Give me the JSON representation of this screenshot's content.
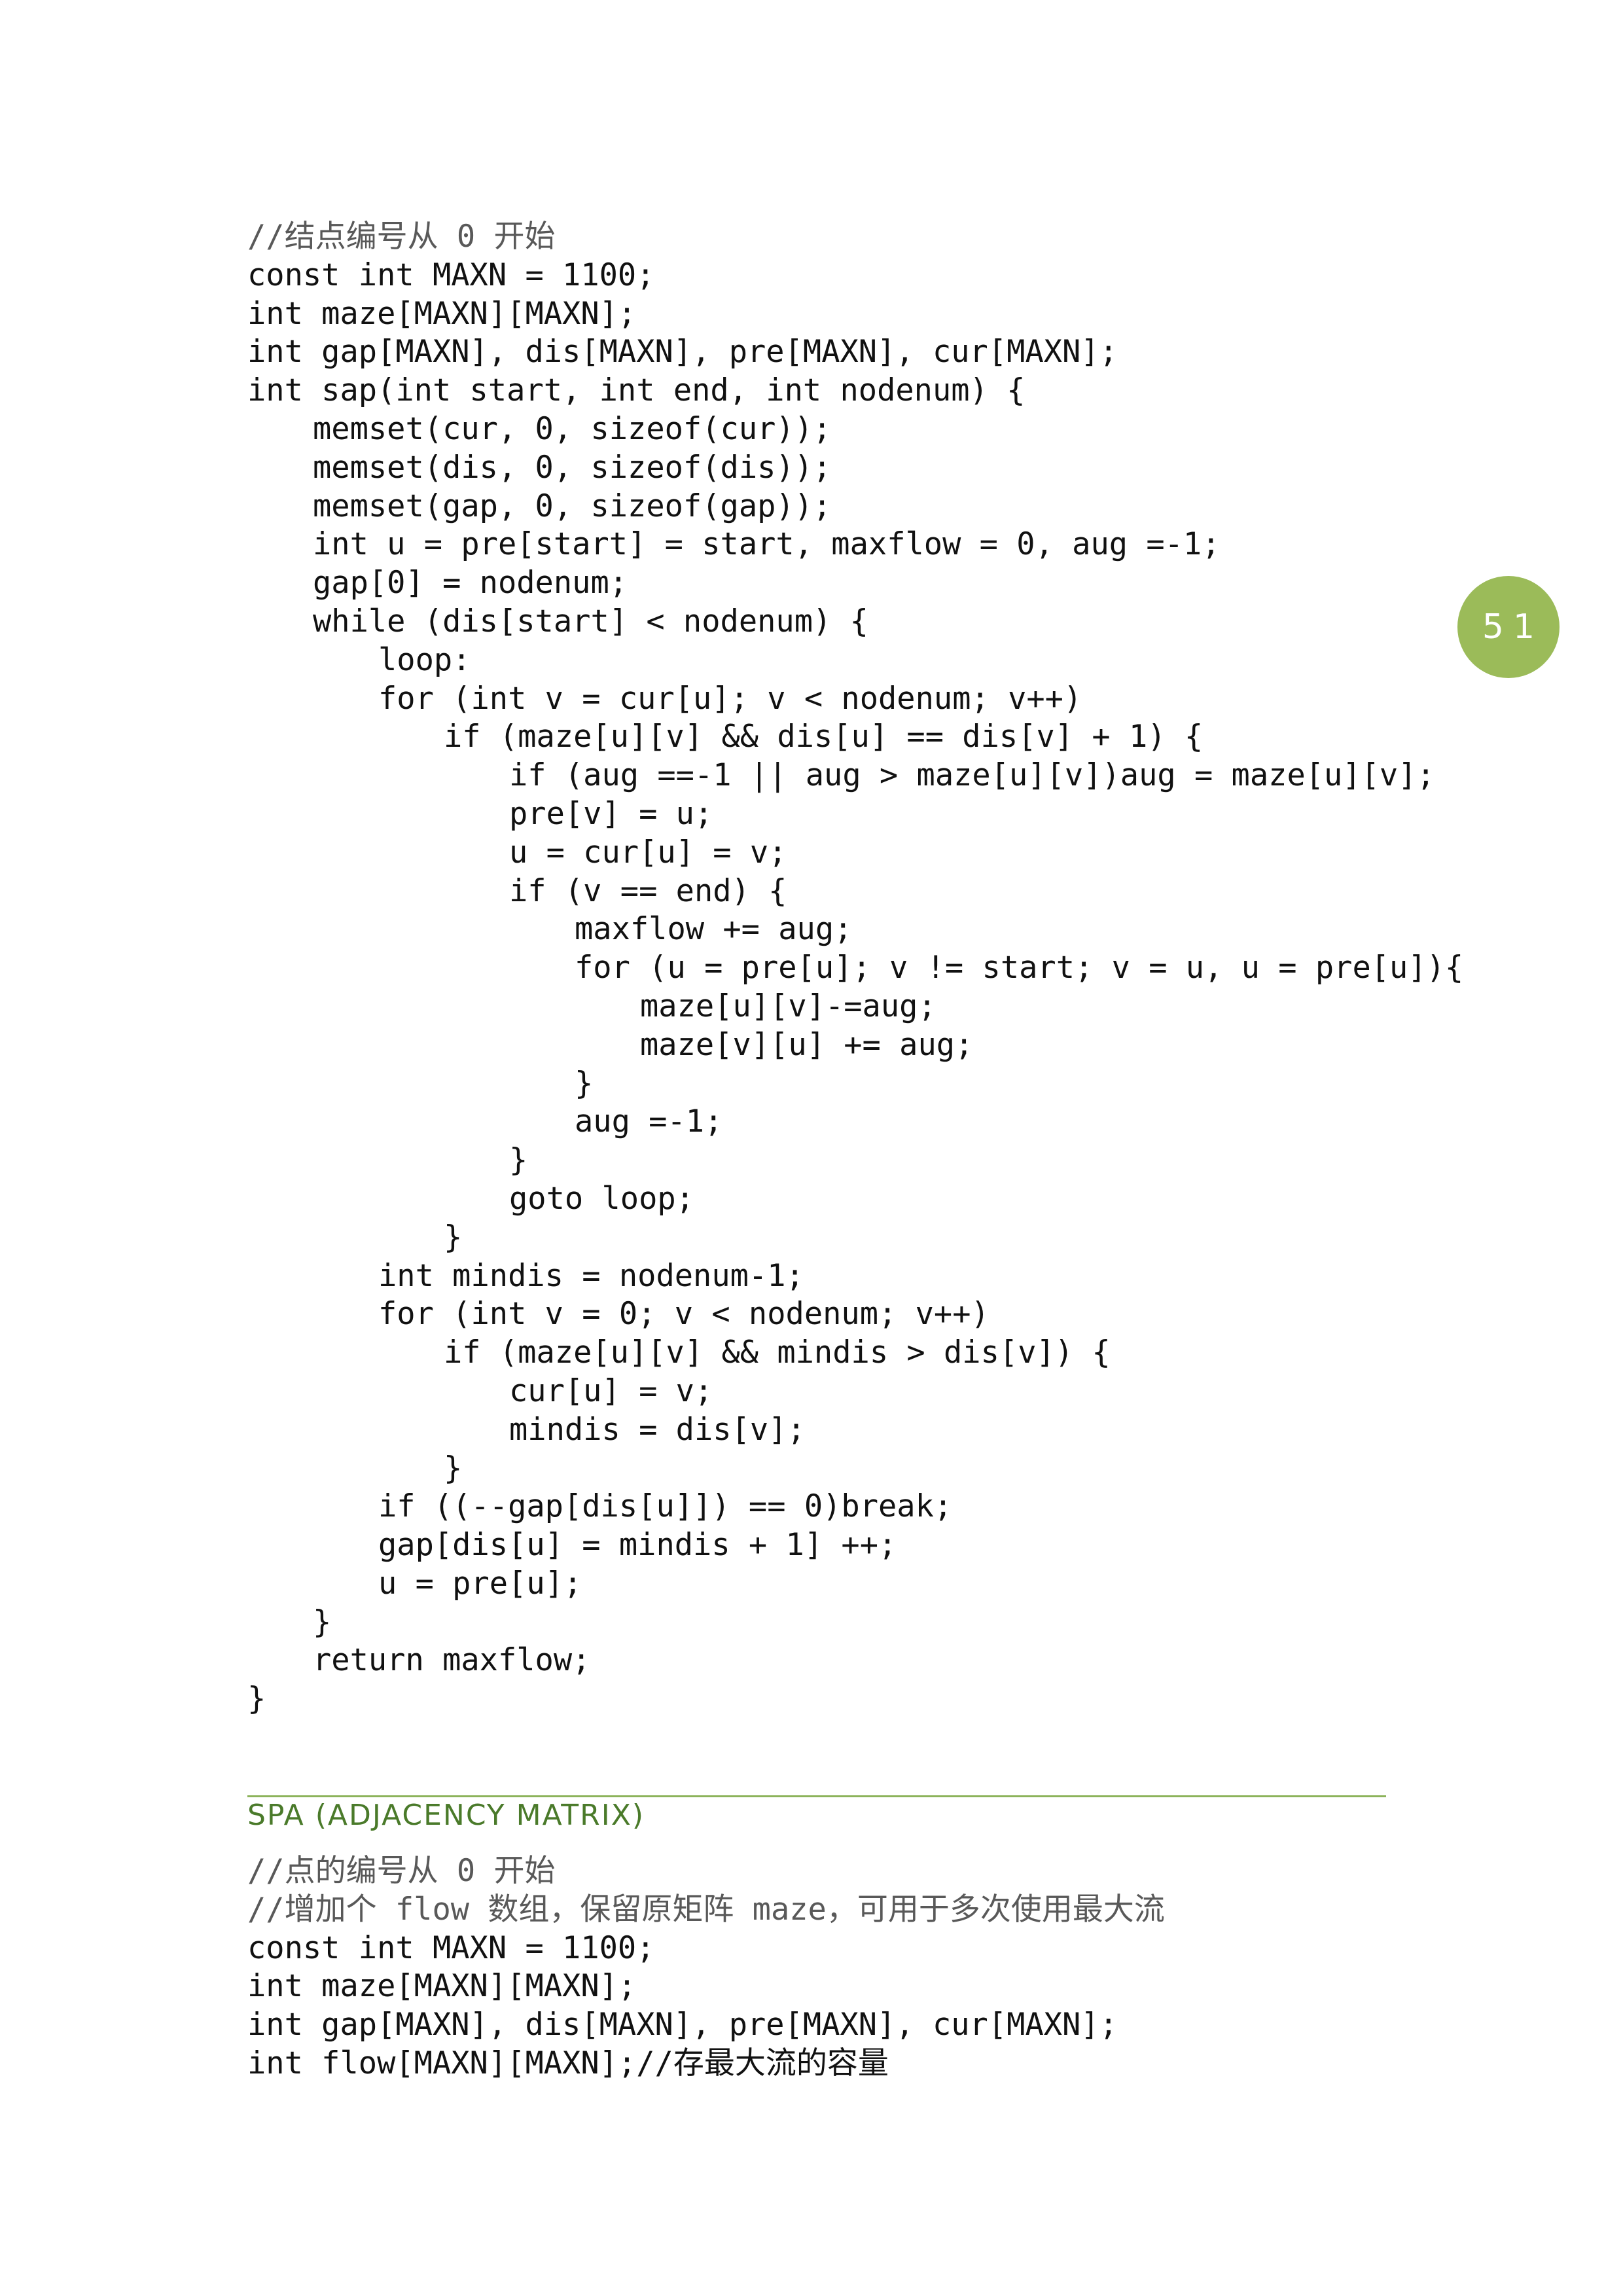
{
  "block1_lines": [
    {
      "indent": 0,
      "text": "//结点编号从 0 开始",
      "comment": true
    },
    {
      "indent": 0,
      "text": "const int MAXN = 1100;"
    },
    {
      "indent": 0,
      "text": "int maze[MAXN][MAXN];"
    },
    {
      "indent": 0,
      "text": "int gap[MAXN], dis[MAXN], pre[MAXN], cur[MAXN];"
    },
    {
      "indent": 0,
      "text": "int sap(int start, int end, int nodenum) {"
    },
    {
      "indent": 1,
      "text": "memset(cur, 0, sizeof(cur));"
    },
    {
      "indent": 1,
      "text": "memset(dis, 0, sizeof(dis));"
    },
    {
      "indent": 1,
      "text": "memset(gap, 0, sizeof(gap));"
    },
    {
      "indent": 1,
      "text": "int u = pre[start] = start, maxflow = 0, aug =-1;"
    },
    {
      "indent": 1,
      "text": "gap[0] = nodenum;"
    },
    {
      "indent": 1,
      "text": "while (dis[start] < nodenum) {"
    },
    {
      "indent": 2,
      "text": "loop:"
    },
    {
      "indent": 2,
      "text": "for (int v = cur[u]; v < nodenum; v++)"
    },
    {
      "indent": 3,
      "text": "if (maze[u][v] && dis[u] == dis[v] + 1) {"
    },
    {
      "indent": 4,
      "text": "if (aug ==-1 || aug > maze[u][v])aug = maze[u][v];"
    },
    {
      "indent": 4,
      "text": "pre[v] = u;"
    },
    {
      "indent": 4,
      "text": "u = cur[u] = v;"
    },
    {
      "indent": 4,
      "text": "if (v == end) {"
    },
    {
      "indent": 5,
      "text": "maxflow += aug;"
    },
    {
      "indent": 5,
      "text": "for (u = pre[u]; v != start; v = u, u = pre[u]){"
    },
    {
      "indent": 6,
      "text": "maze[u][v]-=aug;"
    },
    {
      "indent": 6,
      "text": "maze[v][u] += aug;"
    },
    {
      "indent": 5,
      "text": "}"
    },
    {
      "indent": 5,
      "text": "aug =-1;"
    },
    {
      "indent": 4,
      "text": "}"
    },
    {
      "indent": 4,
      "text": "goto loop;"
    },
    {
      "indent": 3,
      "text": "}"
    },
    {
      "indent": 2,
      "text": "int mindis = nodenum-1;"
    },
    {
      "indent": 2,
      "text": "for (int v = 0; v < nodenum; v++)"
    },
    {
      "indent": 3,
      "text": "if (maze[u][v] && mindis > dis[v]) {"
    },
    {
      "indent": 4,
      "text": "cur[u] = v;"
    },
    {
      "indent": 4,
      "text": "mindis = dis[v];"
    },
    {
      "indent": 3,
      "text": "}"
    },
    {
      "indent": 2,
      "text": "if ((--gap[dis[u]]) == 0)break;"
    },
    {
      "indent": 2,
      "text": "gap[dis[u] = mindis + 1] ++;"
    },
    {
      "indent": 2,
      "text": "u = pre[u];"
    },
    {
      "indent": 1,
      "text": "}"
    },
    {
      "indent": 1,
      "text": "return maxflow;"
    },
    {
      "indent": 0,
      "text": "}"
    }
  ],
  "section_heading": "SPA (ADJACENCY MATRIX)",
  "block2_lines": [
    {
      "indent": 0,
      "text": "//点的编号从 0 开始",
      "comment": true
    },
    {
      "indent": 0,
      "text": "//增加个 flow 数组，保留原矩阵 maze，可用于多次使用最大流",
      "comment": true
    },
    {
      "indent": 0,
      "text": "const int MAXN = 1100;"
    },
    {
      "indent": 0,
      "text": "int maze[MAXN][MAXN];"
    },
    {
      "indent": 0,
      "text": "int gap[MAXN], dis[MAXN], pre[MAXN], cur[MAXN];"
    },
    {
      "indent": 0,
      "text": "int flow[MAXN][MAXN];//存最大流的容量"
    }
  ],
  "page_number": "51"
}
